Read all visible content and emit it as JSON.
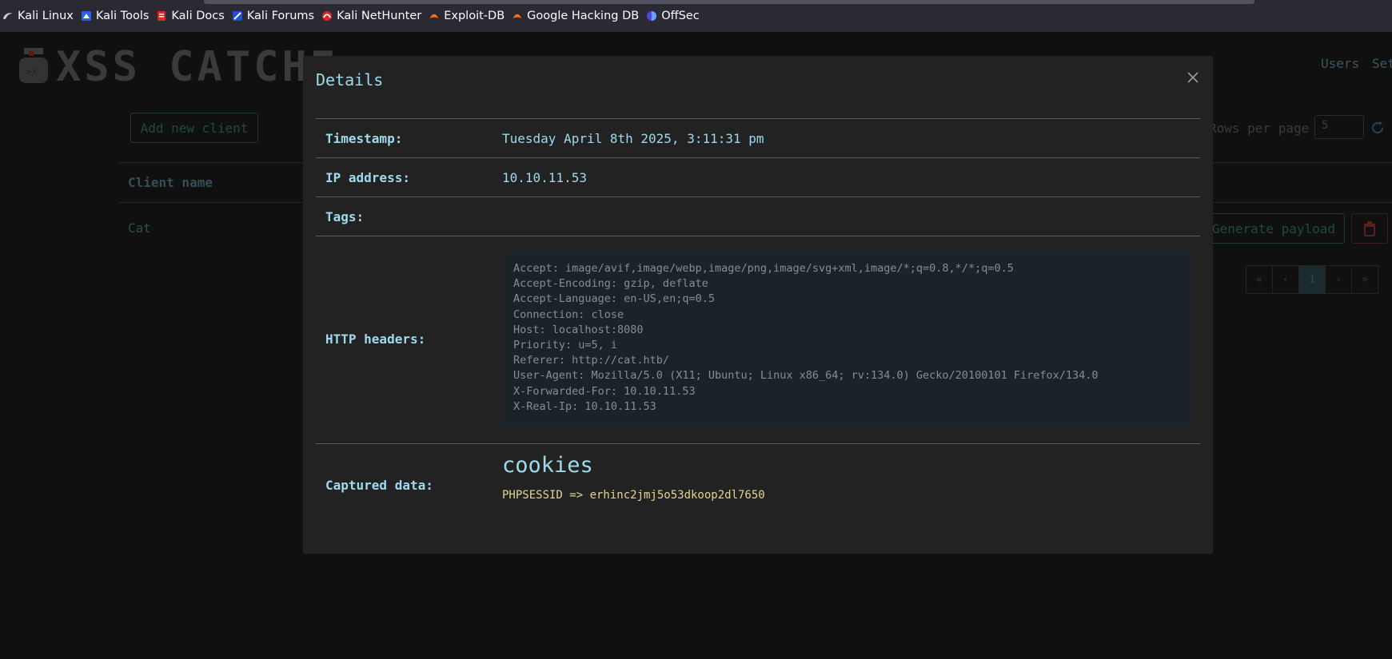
{
  "bookmarks": [
    {
      "label": "Kali Linux",
      "icon": "kali-dragon-icon",
      "color": "#bbbbbb"
    },
    {
      "label": "Kali Tools",
      "icon": "kali-tools-icon",
      "color": "#3b82f6"
    },
    {
      "label": "Kali Docs",
      "icon": "kali-docs-icon",
      "color": "#dc2626"
    },
    {
      "label": "Kali Forums",
      "icon": "kali-forums-icon",
      "color": "#3b82f6"
    },
    {
      "label": "Kali NetHunter",
      "icon": "kali-nethunter-icon",
      "color": "#dc2626"
    },
    {
      "label": "Exploit-DB",
      "icon": "exploit-db-icon",
      "color": "#f97316"
    },
    {
      "label": "Google Hacking DB",
      "icon": "google-hacking-db-icon",
      "color": "#f97316"
    },
    {
      "label": "OffSec",
      "icon": "offsec-icon",
      "color": "#6366f1"
    }
  ],
  "app": {
    "logo_text": "XSS CATCHE",
    "nav_users": "Users",
    "nav_settings": "Set",
    "add_client_label": "Add new client",
    "rows_per_page_label": "Rows per page",
    "rows_per_page_value": "5",
    "column_client_name": "Client name",
    "rows": [
      {
        "client_name": "Cat",
        "generate_label": "Generate payload"
      }
    ],
    "pagination": [
      "«",
      "‹",
      "1",
      "›",
      "»"
    ],
    "accent": "#9fd9ec"
  },
  "modal": {
    "title": "Details",
    "close_glyph": "×",
    "timestamp_label": "Timestamp:",
    "timestamp_value": "Tuesday April 8th 2025, 3:11:31 pm",
    "ip_label": "IP address:",
    "ip_value": "10.10.11.53",
    "tags_label": "Tags:",
    "tags_value": "",
    "headers_label": "HTTP headers:",
    "headers": [
      "Accept: image/avif,image/webp,image/png,image/svg+xml,image/*;q=0.8,*/*;q=0.5",
      "Accept-Encoding: gzip, deflate",
      "Accept-Language: en-US,en;q=0.5",
      "Connection: close",
      "Host: localhost:8080",
      "Priority: u=5, i",
      "Referer: http://cat.htb/",
      "User-Agent: Mozilla/5.0 (X11; Ubuntu; Linux x86_64; rv:134.0) Gecko/20100101 Firefox/134.0",
      "X-Forwarded-For: 10.10.11.53",
      "X-Real-Ip: 10.10.11.53"
    ],
    "captured_label": "Captured data:",
    "cookies_title": "cookies",
    "cookie_line": "PHPSESSID => erhinc2jmj5o53dkoop2dl7650"
  }
}
